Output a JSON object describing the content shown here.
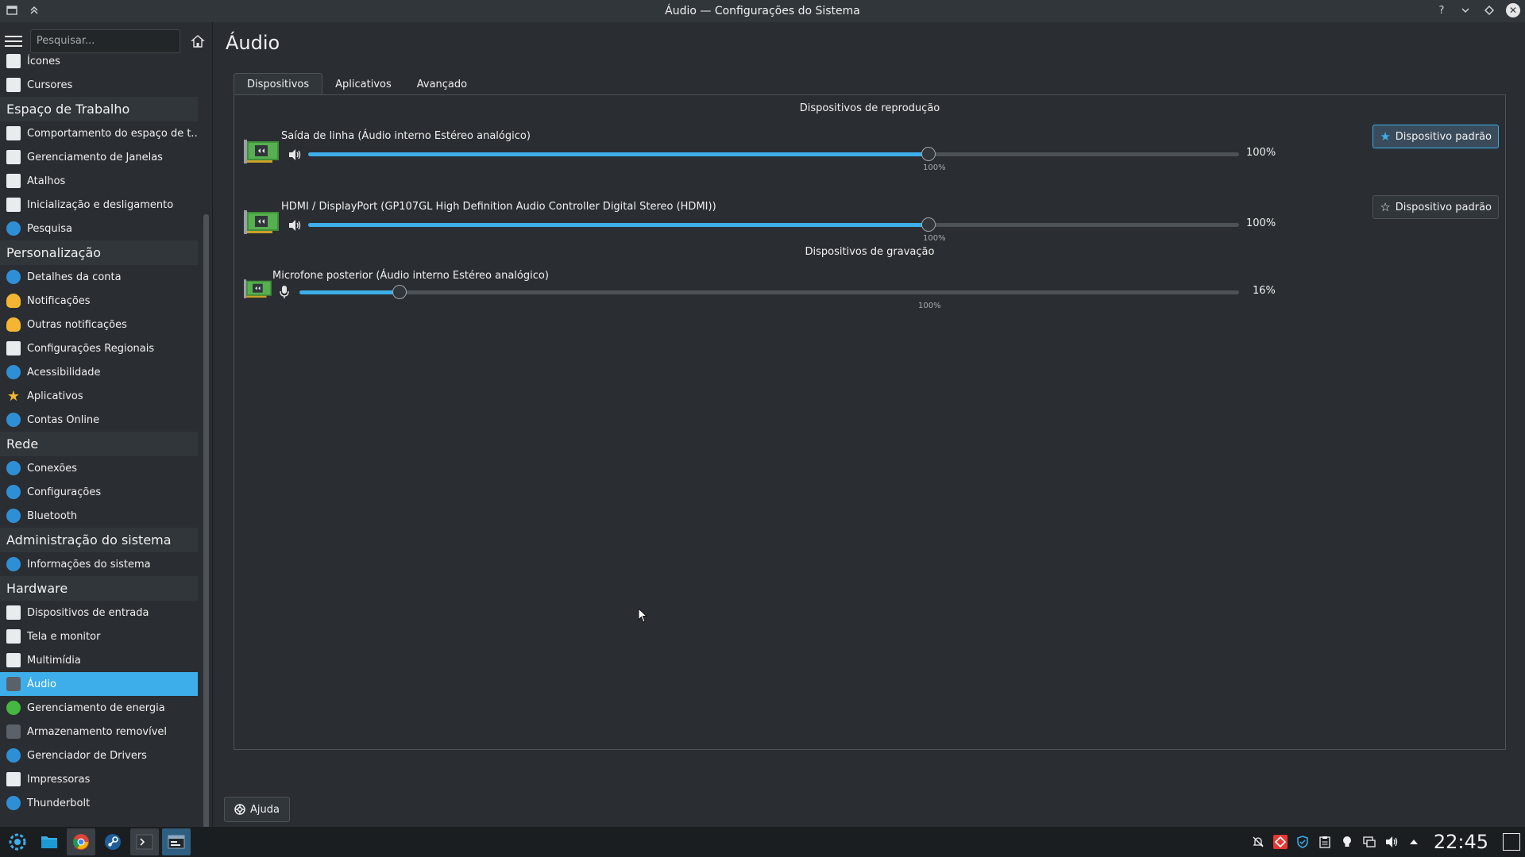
{
  "window": {
    "title": "Áudio — Configurações do Sistema"
  },
  "sidebar": {
    "search_placeholder": "Pesquisar...",
    "items": [
      {
        "type": "item",
        "label": "Ícones",
        "icon": "icons-icon"
      },
      {
        "type": "item",
        "label": "Cursores",
        "icon": "cursor-icon"
      },
      {
        "type": "category",
        "label": "Espaço de Trabalho"
      },
      {
        "type": "item",
        "label": "Comportamento do espaço de t...",
        "icon": "workspace-behavior-icon"
      },
      {
        "type": "item",
        "label": "Gerenciamento de Janelas",
        "icon": "window-management-icon"
      },
      {
        "type": "item",
        "label": "Atalhos",
        "icon": "keyboard-icon"
      },
      {
        "type": "item",
        "label": "Inicialização e desligamento",
        "icon": "startup-icon"
      },
      {
        "type": "item",
        "label": "Pesquisa",
        "icon": "search-icon"
      },
      {
        "type": "category",
        "label": "Personalização"
      },
      {
        "type": "item",
        "label": "Detalhes da conta",
        "icon": "user-icon"
      },
      {
        "type": "item",
        "label": "Notificações",
        "icon": "bell-icon"
      },
      {
        "type": "item",
        "label": "Outras notificações",
        "icon": "bell-icon"
      },
      {
        "type": "item",
        "label": "Configurações Regionais",
        "icon": "regional-icon"
      },
      {
        "type": "item",
        "label": "Acessibilidade",
        "icon": "accessibility-icon"
      },
      {
        "type": "item",
        "label": "Aplicativos",
        "icon": "star-icon"
      },
      {
        "type": "item",
        "label": "Contas Online",
        "icon": "globe-icon"
      },
      {
        "type": "category",
        "label": "Rede"
      },
      {
        "type": "item",
        "label": "Conexões",
        "icon": "globe-icon"
      },
      {
        "type": "item",
        "label": "Configurações",
        "icon": "globe-icon"
      },
      {
        "type": "item",
        "label": "Bluetooth",
        "icon": "bluetooth-icon"
      },
      {
        "type": "category",
        "label": "Administração do sistema"
      },
      {
        "type": "item",
        "label": "Informações do sistema",
        "icon": "info-icon"
      },
      {
        "type": "category",
        "label": "Hardware"
      },
      {
        "type": "item",
        "label": "Dispositivos de entrada",
        "icon": "keyboard-icon"
      },
      {
        "type": "item",
        "label": "Tela e monitor",
        "icon": "monitor-icon"
      },
      {
        "type": "item",
        "label": "Multimídia",
        "icon": "multimedia-icon"
      },
      {
        "type": "item",
        "label": "Áudio",
        "icon": "audio-icon",
        "active": true
      },
      {
        "type": "item",
        "label": "Gerenciamento de energia",
        "icon": "power-icon"
      },
      {
        "type": "item",
        "label": "Armazenamento removível",
        "icon": "usb-icon"
      },
      {
        "type": "item",
        "label": "Gerenciador de Drivers",
        "icon": "driver-icon"
      },
      {
        "type": "item",
        "label": "Impressoras",
        "icon": "printer-icon"
      },
      {
        "type": "item",
        "label": "Thunderbolt",
        "icon": "thunderbolt-icon"
      }
    ]
  },
  "main": {
    "title": "Áudio",
    "tabs": [
      "Dispositivos",
      "Aplicativos",
      "Avançado"
    ],
    "active_tab": "Dispositivos",
    "playback_title": "Dispositivos de reprodução",
    "recording_title": "Dispositivos de gravação",
    "playback_devices": [
      {
        "name": "Saída de linha (Áudio interno Estéreo analógico)",
        "volume": 100,
        "volume_label": "100%",
        "mark_label": "100%",
        "default_label": "Dispositivo padrão",
        "is_default": true
      },
      {
        "name": "HDMI / DisplayPort (GP107GL High Definition Audio Controller Digital Stereo (HDMI))",
        "volume": 100,
        "volume_label": "100%",
        "mark_label": "100%",
        "default_label": "Dispositivo padrão",
        "is_default": false
      }
    ],
    "recording_devices": [
      {
        "name": "Microfone posterior (Áudio interno Estéreo analógico)",
        "volume": 16,
        "volume_label": "16%",
        "mark_label": "100%"
      }
    ],
    "help_label": "Ajuda"
  },
  "taskbar": {
    "apps": [
      "app-launcher-icon",
      "file-manager-icon",
      "chrome-icon",
      "steam-icon",
      "terminal-icon",
      "system-settings-icon"
    ],
    "clock": "22:45"
  },
  "colors": {
    "accent": "#3daee9",
    "window_bg": "#2a2e32",
    "sidebar_category_bg": "#31363b"
  }
}
